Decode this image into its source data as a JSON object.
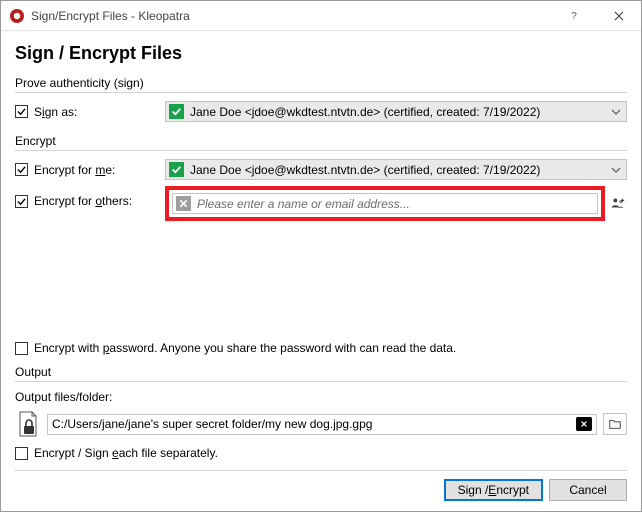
{
  "window": {
    "title": "Sign/Encrypt Files - Kleopatra",
    "heading": "Sign / Encrypt Files"
  },
  "groups": {
    "sign": "Prove authenticity (sign)",
    "encrypt": "Encrypt",
    "output": "Output"
  },
  "sign_as": {
    "label_pre": "S",
    "label_ul": "i",
    "label_post": "gn as:",
    "checked": true,
    "value": "Jane Doe <jdoe@wkdtest.ntvtn.de> (certified, created: 7/19/2022)"
  },
  "encrypt_me": {
    "label_pre": "Encrypt for ",
    "label_ul": "m",
    "label_post": "e:",
    "checked": true,
    "value": "Jane Doe <jdoe@wkdtest.ntvtn.de> (certified, created: 7/19/2022)"
  },
  "encrypt_others": {
    "label_pre": "Encrypt for ",
    "label_ul": "o",
    "label_post": "thers:",
    "checked": true,
    "placeholder": "Please enter a name or email address..."
  },
  "encrypt_pw": {
    "label_pre": "Encrypt with ",
    "label_ul": "p",
    "label_post": "assword. Anyone you share the password with can read the data.",
    "checked": false
  },
  "output": {
    "label": "Output files/folder:",
    "path": "C:/Users/jane/jane's super secret folder/my new dog.jpg.gpg"
  },
  "each_file": {
    "label_pre": "Encrypt / Sign ",
    "label_ul": "e",
    "label_post": "ach file separately.",
    "checked": false
  },
  "buttons": {
    "primary_pre": "Sign / ",
    "primary_ul": "E",
    "primary_post": "ncrypt",
    "cancel": "Cancel"
  }
}
